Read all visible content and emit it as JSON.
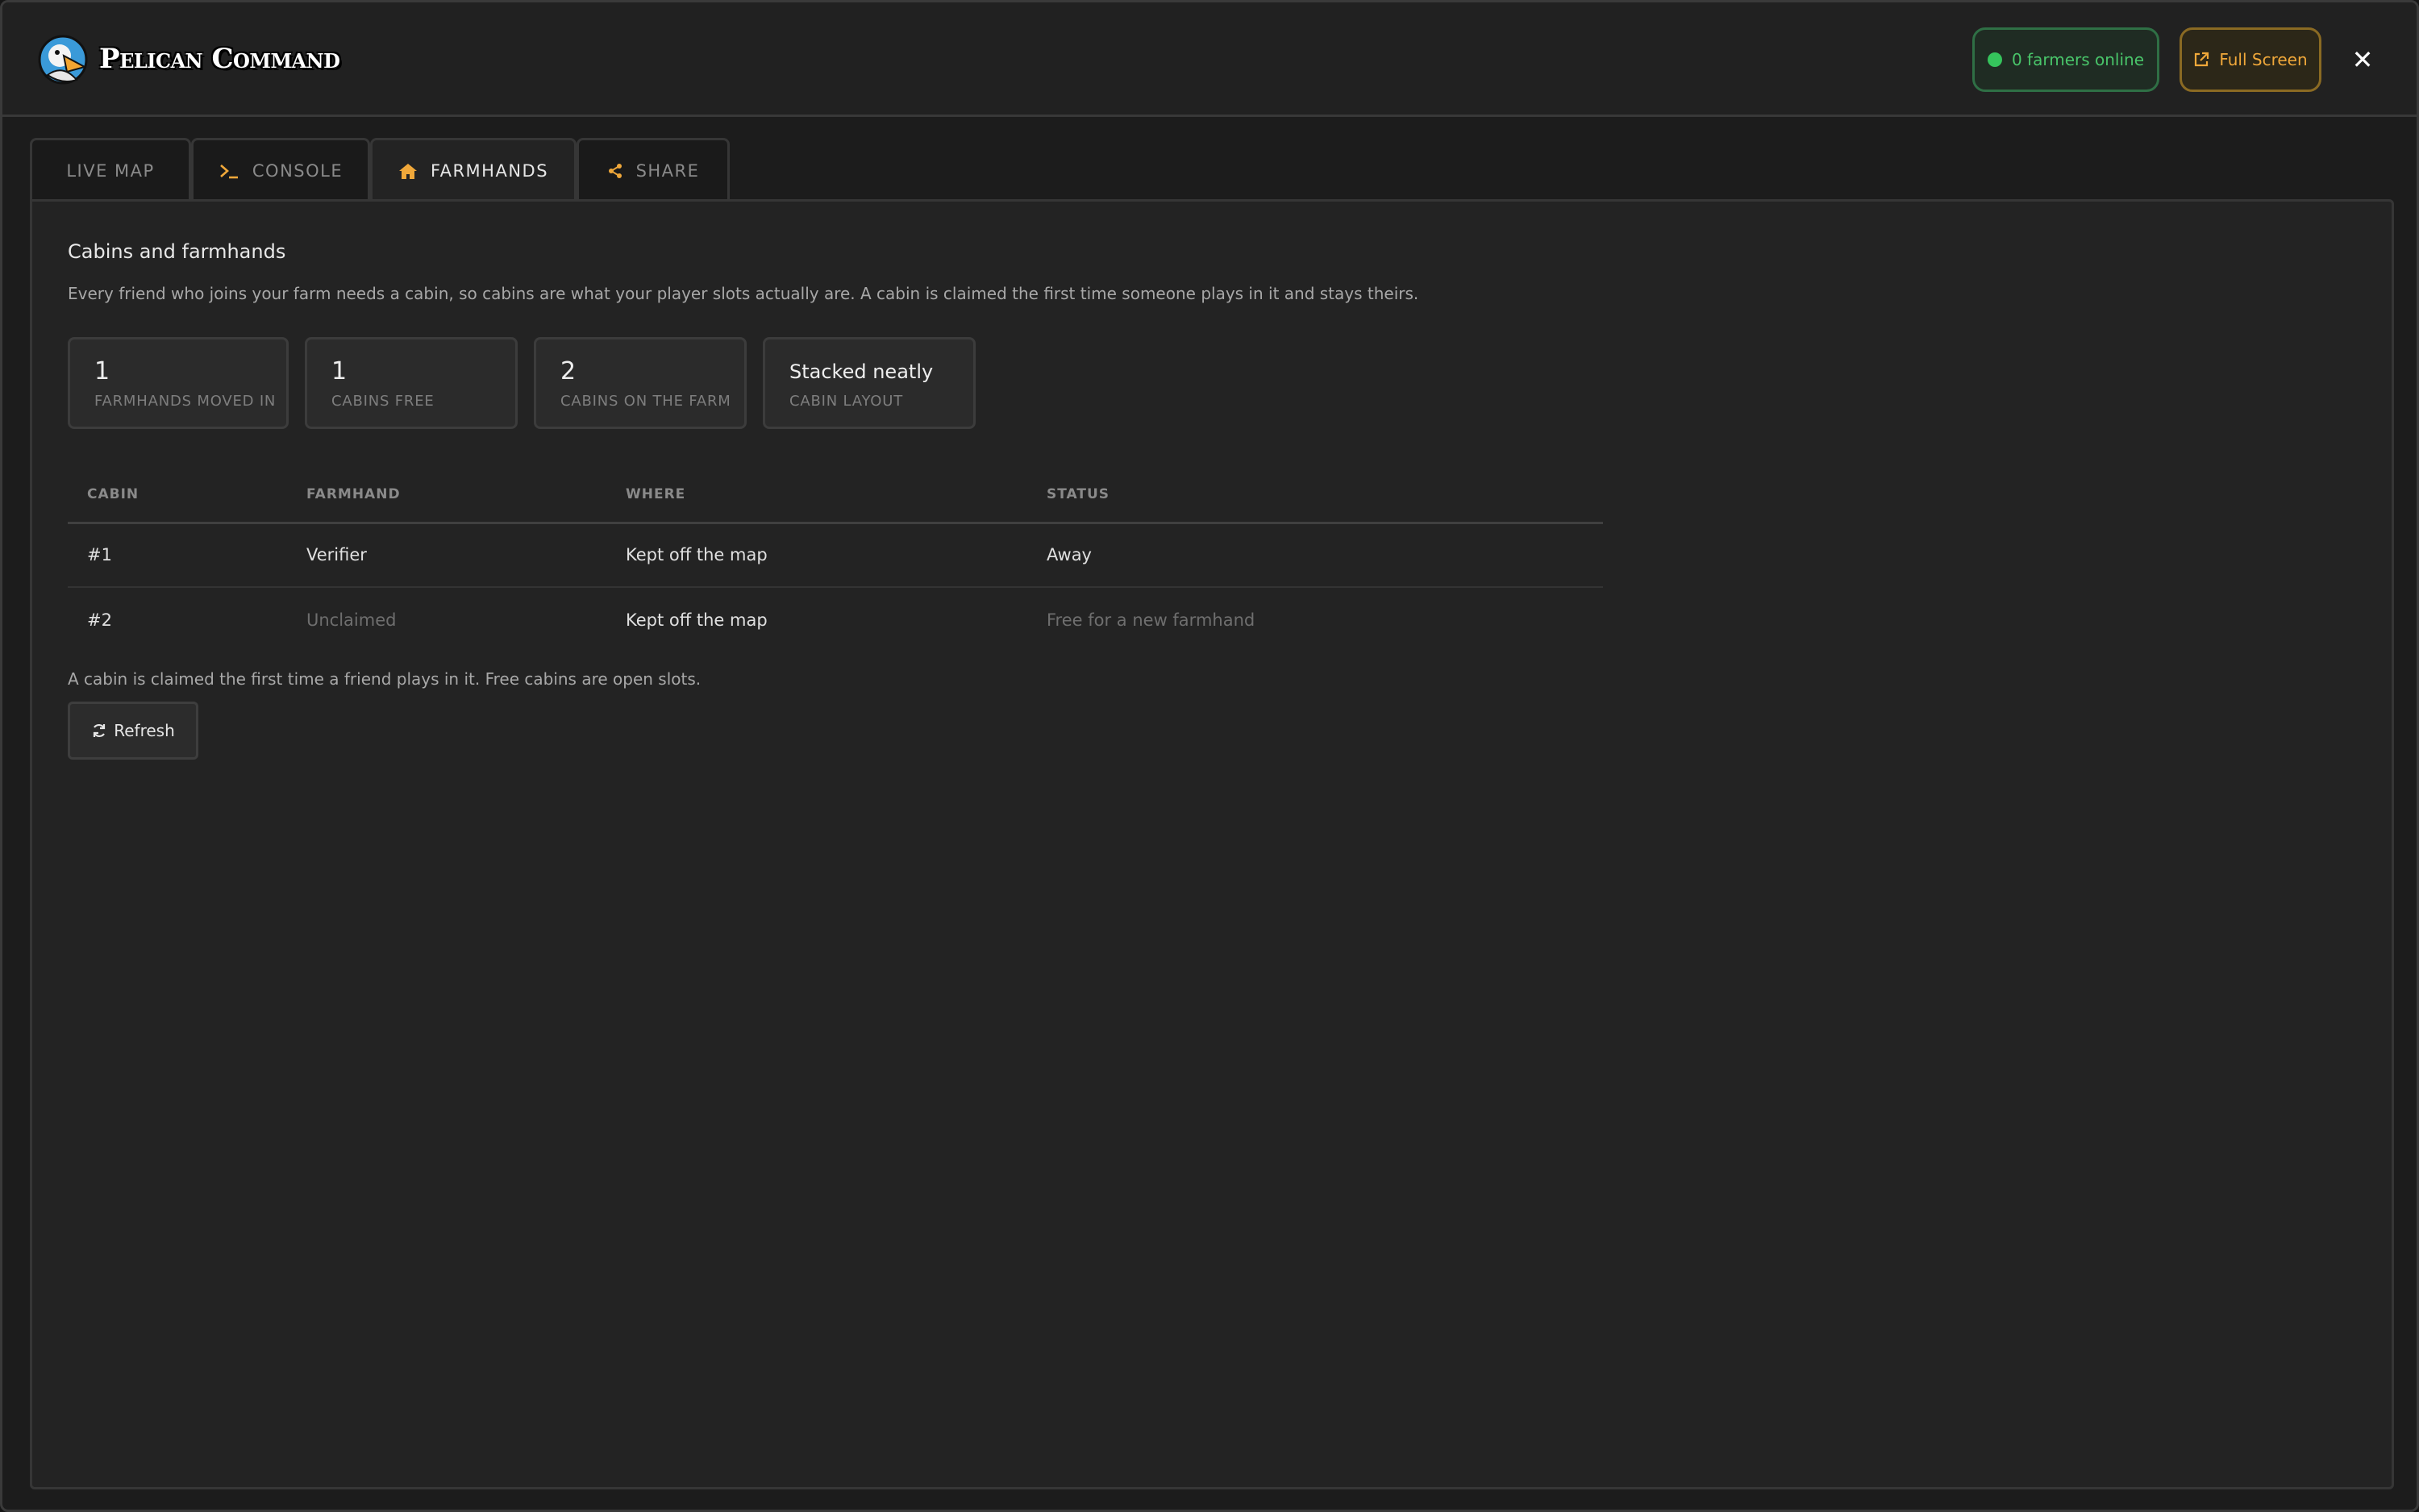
{
  "header": {
    "brand": "Pelican Command",
    "online_label": "0 farmers online",
    "fullscreen_label": "Full Screen",
    "close_glyph": "✕",
    "logo_icon": "pelican-logo-icon",
    "online_color": "#35c45c",
    "accent": "#f0a83a"
  },
  "tabs": [
    {
      "label": "LIVE MAP",
      "icon": "",
      "active": false
    },
    {
      "label": "CONSOLE",
      "icon": "terminal-icon",
      "active": false
    },
    {
      "label": "FARMHANDS",
      "icon": "house-icon",
      "active": true
    },
    {
      "label": "SHARE",
      "icon": "share-icon",
      "active": false
    }
  ],
  "panel": {
    "title": "Cabins and farmhands",
    "description": "Every friend who joins your farm needs a cabin, so cabins are what your player slots actually are. A cabin is claimed the first time someone plays in it and stays theirs.",
    "stats": [
      {
        "value": "1",
        "label": "FARMHANDS MOVED IN"
      },
      {
        "value": "1",
        "label": "CABINS FREE"
      },
      {
        "value": "2",
        "label": "CABINS ON THE FARM"
      },
      {
        "value": "Stacked neatly",
        "label": "CABIN LAYOUT"
      }
    ],
    "table": {
      "headers": [
        "CABIN",
        "FARMHAND",
        "WHERE",
        "STATUS"
      ],
      "rows": [
        {
          "cabin": "#1",
          "farmhand": "Verifier",
          "where": "Kept off the map",
          "status": "Away"
        },
        {
          "cabin": "#2",
          "farmhand": "Unclaimed",
          "where": "Kept off the map",
          "status": "Free for a new farmhand"
        }
      ]
    },
    "footnote": "A cabin is claimed the first time a friend plays in it. Free cabins are open slots.",
    "refresh_label": "Refresh"
  }
}
